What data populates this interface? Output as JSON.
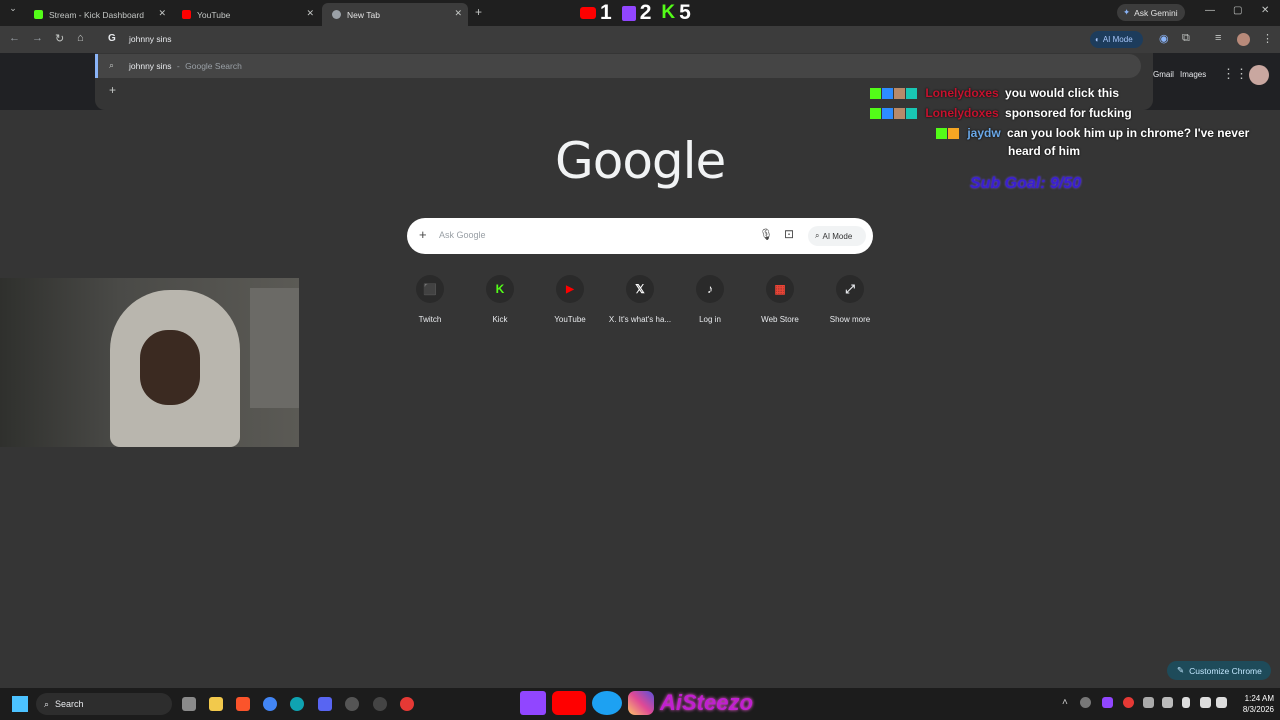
{
  "tabs": [
    {
      "label": "Stream - Kick Dashboard",
      "icon": "kick-icon",
      "color": "#53fc18"
    },
    {
      "label": "YouTube",
      "icon": "youtube-icon",
      "color": "#ff0000"
    },
    {
      "label": "New Tab",
      "icon": "chrome-icon",
      "color": "#9aa0a6"
    }
  ],
  "stream_counts": {
    "youtube": "1",
    "twitch": "2",
    "kick": "5"
  },
  "ask_gemini": "Ask Gemini",
  "omnibox": {
    "value": "johnny sins",
    "ai_mode": "AI Mode"
  },
  "suggestion": {
    "query": "johnny sins",
    "separator": "-",
    "source": "Google Search"
  },
  "topright": {
    "gmail": "Gmail",
    "images": "Images"
  },
  "logo": "Google",
  "search": {
    "placeholder": "Ask Google",
    "ai_mode": "AI Mode"
  },
  "shortcuts": [
    {
      "label": "Twitch",
      "glyph": "⬛",
      "color": "#9146ff"
    },
    {
      "label": "Kick",
      "glyph": "K",
      "color": "#53fc18"
    },
    {
      "label": "YouTube",
      "glyph": "▶",
      "color": "#ff0000"
    },
    {
      "label": "X. It's what's ha...",
      "glyph": "𝕏",
      "color": "#ffffff"
    },
    {
      "label": "Log in",
      "glyph": "♪",
      "color": "#ffffff"
    },
    {
      "label": "Web Store",
      "glyph": "▦",
      "color": "#ea4335"
    },
    {
      "label": "Show more",
      "glyph": "⤢",
      "color": "#e8eaed"
    }
  ],
  "chat": [
    {
      "user": "Lonelydoxes",
      "user_color": "#c4122e",
      "message": "you would click this"
    },
    {
      "user": "Lonelydoxes",
      "user_color": "#c4122e",
      "message": "sponsored for fucking"
    },
    {
      "user": "jaydw",
      "user_color": "#6aa8e8",
      "message": "can you look him up in chrome? I've never",
      "message2": "heard of him"
    }
  ],
  "sub_goal": "Sub Goal: 9/50",
  "customize": "Customize Chrome",
  "taskbar": {
    "search": "Search",
    "time": "1:24 AM",
    "date": "8/3/2026",
    "brand": "AiSteezo"
  }
}
